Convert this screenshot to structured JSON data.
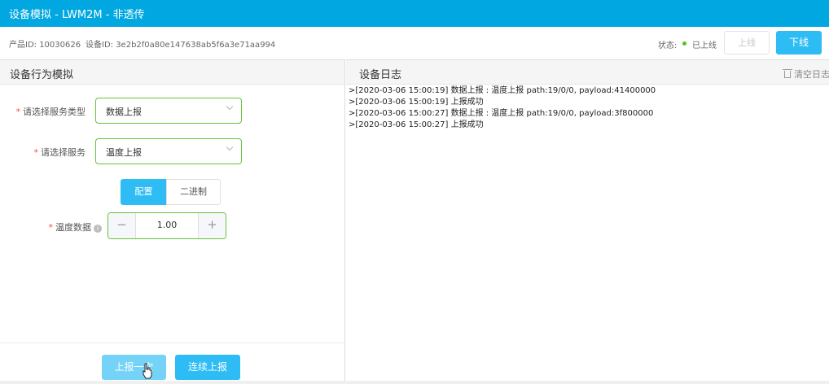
{
  "window": {
    "title": "设备模拟 - LWM2M - 非透传"
  },
  "info": {
    "product_id": "产品ID: 10030626",
    "device_id": "设备ID: 3e2b2f0a80e147638ab5f6a3e71aa994",
    "status_label": "状态:",
    "status_value": "已上线",
    "status_color": "#52c41a",
    "online_button": "上线",
    "offline_button": "下线"
  },
  "simulator": {
    "title": "设备行为模拟",
    "service_type": {
      "required_mark": "*",
      "label": "请选择服务类型",
      "value": "数据上报"
    },
    "service": {
      "required_mark": "*",
      "label": "请选择服务",
      "value": "温度上报"
    },
    "tabs": [
      {
        "label": "配置",
        "active": true
      },
      {
        "label": "二进制",
        "active": false
      }
    ],
    "temperature": {
      "required_mark": "*",
      "label": "温度数据",
      "info_icon": "info-icon",
      "value": "1.00",
      "minus": "−",
      "plus": "+"
    },
    "report_once_button": "上报一次",
    "report_continuous_button": "连续上报"
  },
  "log": {
    "title": "设备日志",
    "clear_button": "清空日志",
    "entries": [
      ">[2020-03-06 15:00:19] 数据上报 : 温度上报  path:19/0/0, payload:41400000",
      ">[2020-03-06 15:00:19] 上报成功",
      ">[2020-03-06 15:00:27] 数据上报 : 温度上报  path:19/0/0, payload:3f800000",
      ">[2020-03-06 15:00:27] 上报成功"
    ]
  },
  "colors": {
    "brand": "#00a7e0",
    "accent": "#2ebcf4",
    "valid_border": "#67c23a",
    "required": "#f04e4e"
  }
}
